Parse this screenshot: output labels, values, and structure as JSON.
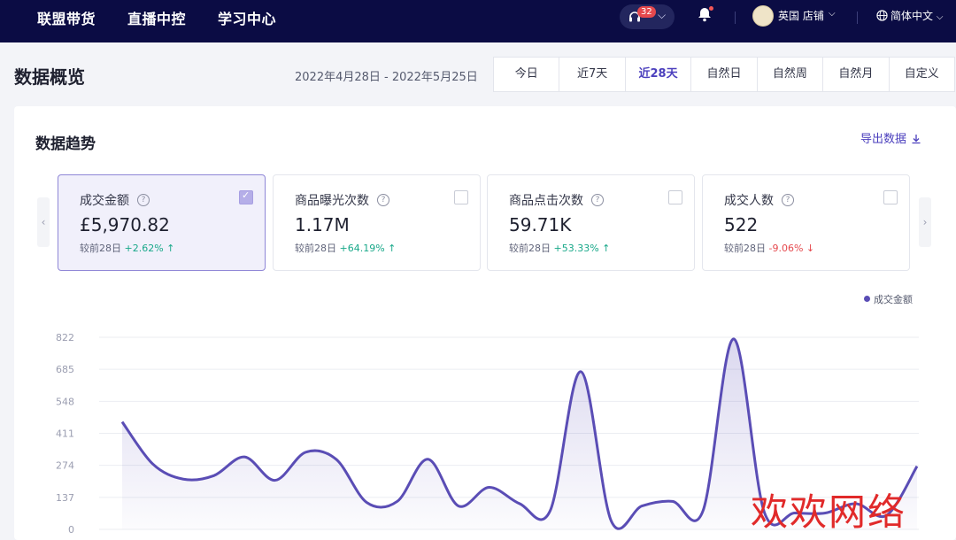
{
  "nav": {
    "items": [
      "联盟带货",
      "直播中控",
      "学习中心"
    ],
    "badge_count": "32",
    "store_name": "英国 店铺",
    "language": "简体中文"
  },
  "header": {
    "title": "数据概览",
    "date_range": "2022年4月28日 - 2022年5月25日",
    "range_tabs": [
      "今日",
      "近7天",
      "近28天",
      "自然日",
      "自然周",
      "自然月",
      "自定义"
    ],
    "active_tab": "近28天"
  },
  "trend": {
    "title": "数据趋势",
    "export_label": "导出数据"
  },
  "metrics": [
    {
      "label": "成交金额",
      "value": "£5,970.82",
      "compare_label": "较前28日",
      "change": "+2.62%",
      "direction": "up",
      "checked": true
    },
    {
      "label": "商品曝光次数",
      "value": "1.17M",
      "compare_label": "较前28日",
      "change": "+64.19%",
      "direction": "up",
      "checked": false
    },
    {
      "label": "商品点击次数",
      "value": "59.71K",
      "compare_label": "较前28日",
      "change": "+53.33%",
      "direction": "up",
      "checked": false
    },
    {
      "label": "成交人数",
      "value": "522",
      "compare_label": "较前28日",
      "change": "-9.06%",
      "direction": "down",
      "checked": false
    }
  ],
  "icons": {
    "headset": "headset-icon",
    "bell": "bell-icon",
    "globe": "globe-icon",
    "download": "download-icon",
    "help": "help-icon",
    "prev": "chevron-left-icon",
    "next": "chevron-right-icon"
  },
  "colors": {
    "nav_bg": "#0b0c44",
    "accent": "#4b3fbd",
    "series": "#5a4db5",
    "up": "#18a889",
    "down": "#e5484d"
  },
  "watermark": "欢欢网络",
  "chart_data": {
    "type": "area",
    "series": [
      {
        "name": "成交金额",
        "values": [
          460,
          280,
          215,
          230,
          310,
          210,
          330,
          300,
          115,
          120,
          300,
          100,
          180,
          110,
          80,
          675,
          35,
          100,
          120,
          80,
          815,
          75,
          70,
          70,
          110,
          60,
          270
        ]
      }
    ],
    "ylim": [
      0,
      822
    ],
    "yticks": [
      0,
      137,
      274,
      411,
      548,
      685,
      822
    ],
    "grid": true,
    "legend": "top-right"
  }
}
